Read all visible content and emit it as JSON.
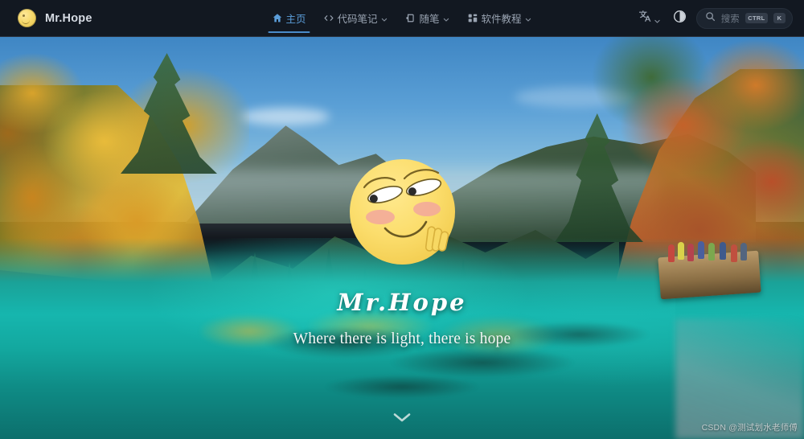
{
  "site": {
    "brand_name": "Mr.Hope",
    "brand_logo_icon": "smiley-avatar-icon"
  },
  "navbar": {
    "menu": [
      {
        "label": "主页",
        "icon": "home-icon",
        "active": true,
        "has_dropdown": false
      },
      {
        "label": "代码笔记",
        "icon": "code-icon",
        "active": false,
        "has_dropdown": true
      },
      {
        "label": "随笔",
        "icon": "pen-icon",
        "active": false,
        "has_dropdown": true
      },
      {
        "label": "软件教程",
        "icon": "apps-icon",
        "active": false,
        "has_dropdown": true
      }
    ],
    "language": {
      "icon": "translate-icon",
      "has_dropdown": true
    },
    "theme_toggle": {
      "icon": "contrast-circle-icon"
    },
    "search": {
      "icon": "search-icon",
      "placeholder": "搜索",
      "shortcut_modifier": "CTRL",
      "shortcut_key": "K"
    }
  },
  "hero": {
    "avatar_icon": "smirking-face-avatar",
    "title": "Mr.Hope",
    "tagline": "Where there is light, there is hope",
    "scroll_hint_icon": "chevron-down-icon",
    "background_alt": "autumn-lake-mountain-photo"
  },
  "watermark": {
    "text": "CSDN @测试划水老师傅"
  },
  "colors": {
    "navbar_bg": "#121821",
    "navbar_border": "#2a3442",
    "brand_text": "#d6dbe3",
    "nav_text": "#9aa4b2",
    "nav_active": "#5b9dd9",
    "search_bg": "#1c242f",
    "kbd_bg": "#333c49",
    "hero_title": "#ffffff",
    "accent_yellow": "#f5d768",
    "lake_teal": "#16b6ae"
  }
}
